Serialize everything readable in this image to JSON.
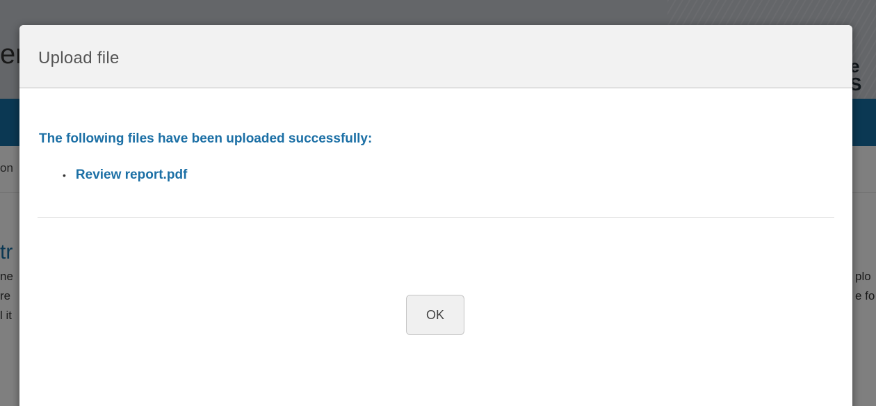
{
  "background": {
    "header_left_text": "er",
    "header_right_text": "e S",
    "breadcrumb_fragment": "on",
    "heading_fragment": "tr",
    "paragraph_left_lines": [
      "ne",
      "re",
      "l it"
    ],
    "paragraph_right_lines": [
      "plo",
      "e fo"
    ]
  },
  "dialog": {
    "title": "Upload file",
    "message": "The following files have been uploaded successfully:",
    "files": [
      "Review report.pdf"
    ],
    "bullet": "•",
    "ok_label": "OK"
  },
  "colors": {
    "accent": "#1b6fa5",
    "nav_bar": "#1670a6",
    "overlay": "rgba(0,0,0,0.5)"
  }
}
